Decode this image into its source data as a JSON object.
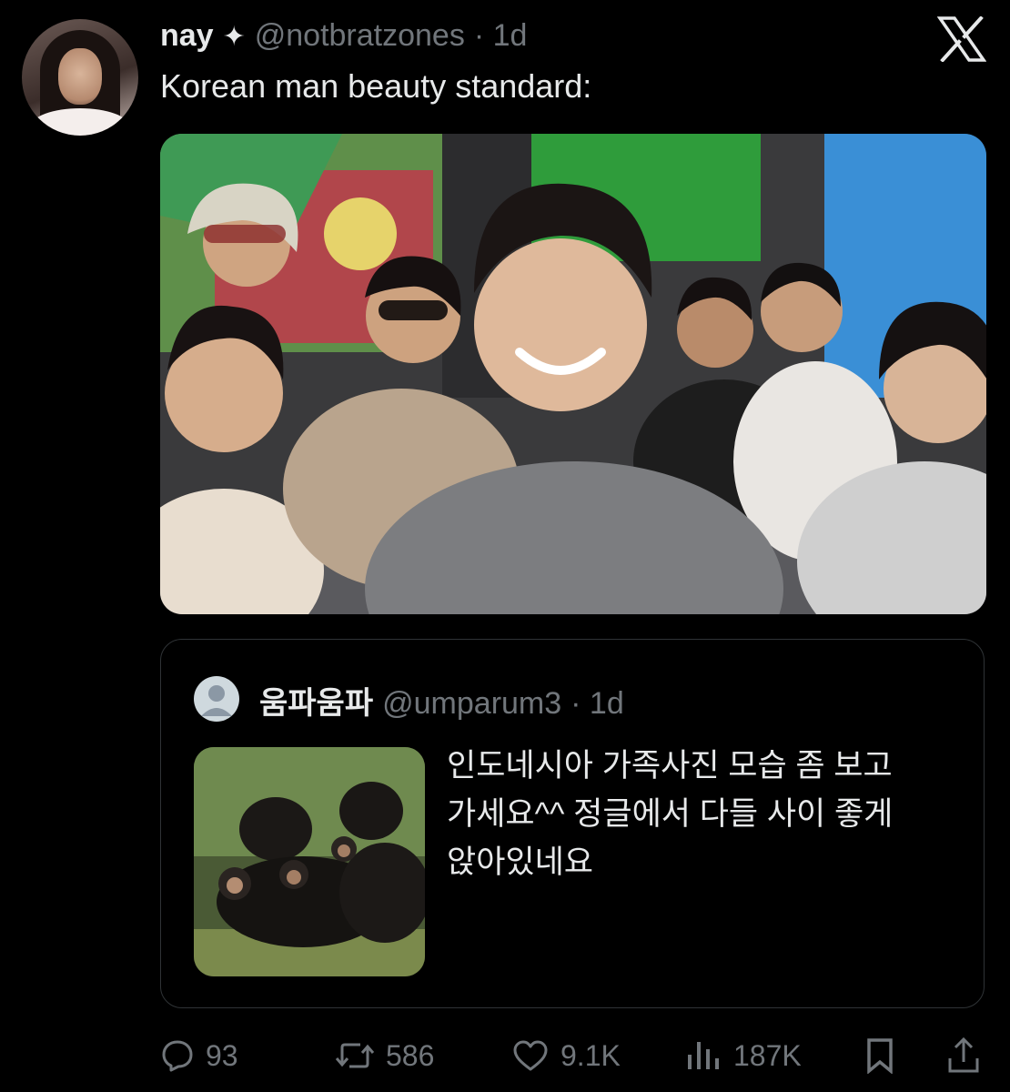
{
  "tweet": {
    "author_name": "nay",
    "badge": "✦",
    "handle": "@notbratzones",
    "time": "· 1d",
    "text": "Korean man beauty standard:"
  },
  "quoted_tweet": {
    "author_name": "움파움파",
    "handle": "@umparum3",
    "time": "· 1d",
    "text": "인도네시아 가족사진 모습 좀 보고 가세요^^ 정글에서 다들 사이 좋게 앉아있네요"
  },
  "actions": {
    "replies": "93",
    "reposts": "586",
    "likes": "9.1K",
    "views": "187K"
  },
  "icons": {
    "close": "x-logo-icon",
    "reply": "comment-icon",
    "repost": "repost-icon",
    "like": "heart-icon",
    "views": "views-icon",
    "bookmark": "bookmark-icon",
    "share": "share-icon"
  },
  "colors": {
    "background": "#000000",
    "text": "#e7e9ea",
    "secondary": "#71767b",
    "border": "#2f3336"
  }
}
